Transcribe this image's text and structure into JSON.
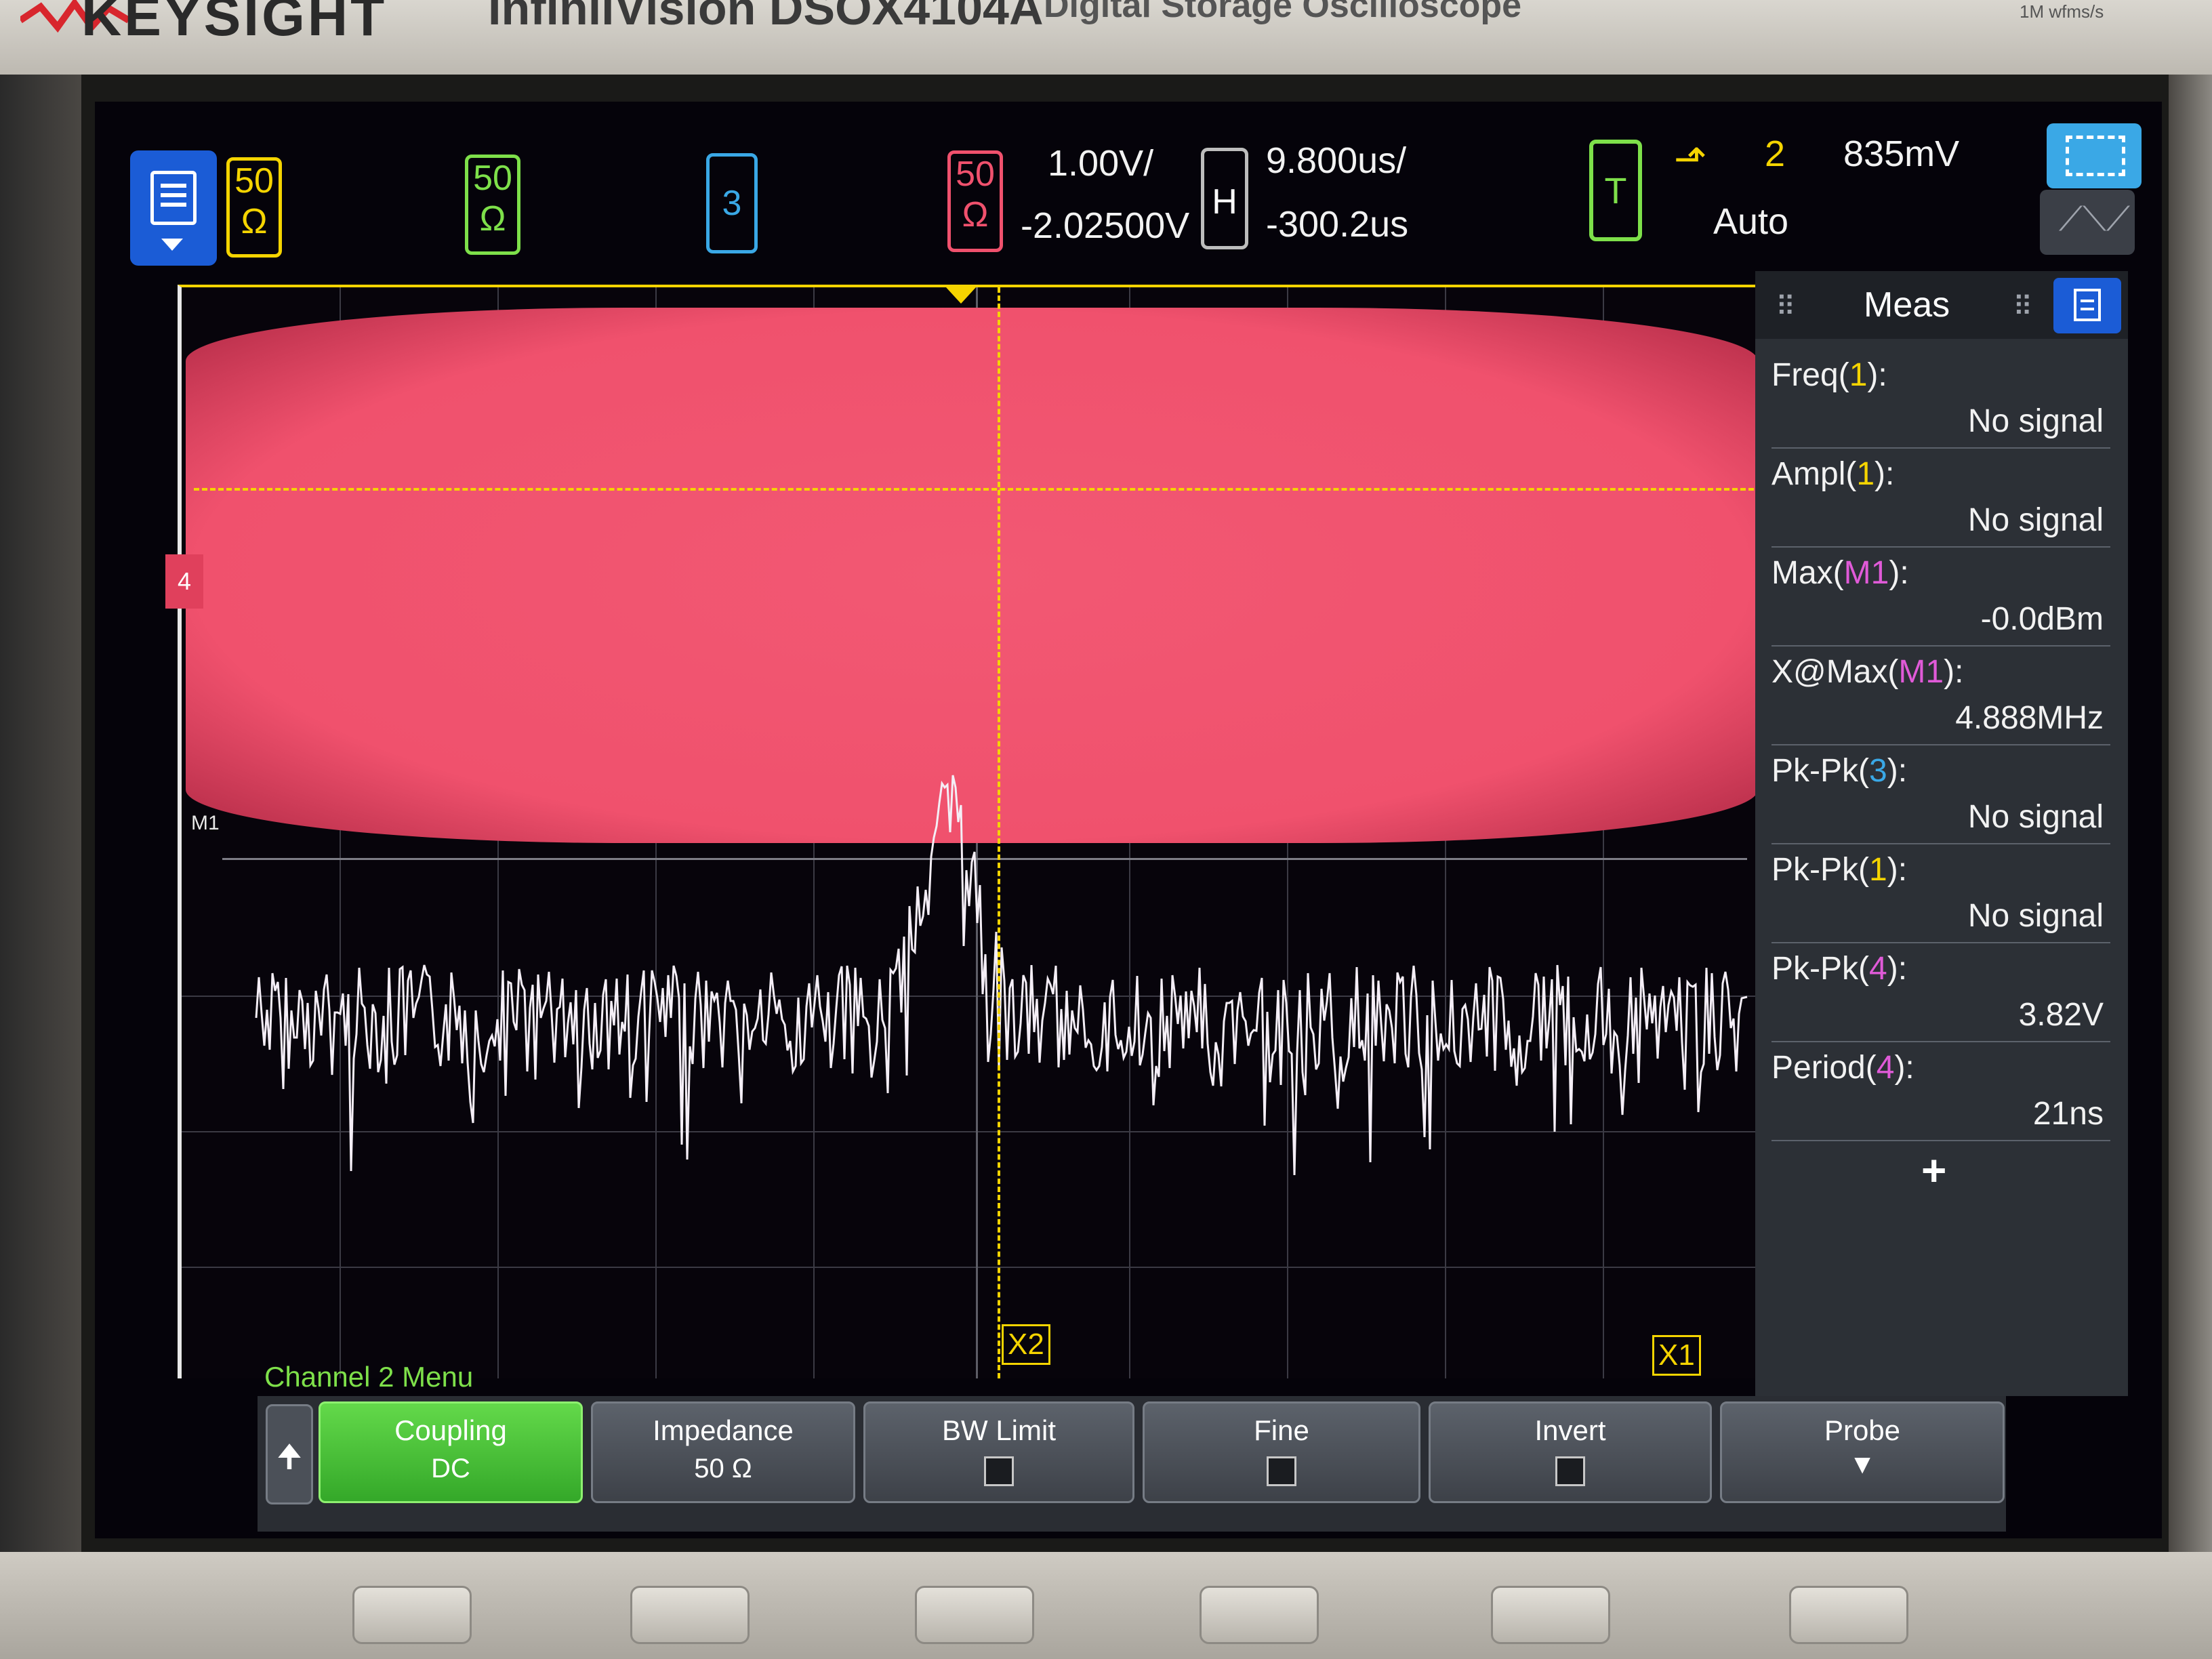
{
  "bezel": {
    "brand": "KEYSIGHT",
    "model": "InfiniiVision DSOX4104A",
    "series": "Digital Storage Oscilloscope",
    "rate": "1M wfms/s"
  },
  "channels": [
    {
      "id": "1",
      "label_top": "50",
      "label_bottom": "Ω",
      "color": "#f5d400"
    },
    {
      "id": "2",
      "label_top": "50",
      "label_bottom": "Ω",
      "color": "#7ee04a"
    },
    {
      "id": "3",
      "label_top": "3",
      "label_bottom": "",
      "color": "#3aa8e6"
    },
    {
      "id": "4",
      "label_top": "50",
      "label_bottom": "Ω",
      "color": "#f0516d"
    }
  ],
  "vertical": {
    "scale": "1.00V/",
    "offset": "-2.02500V"
  },
  "horizontal": {
    "label": "H",
    "scale": "9.800us/",
    "delay": "-300.2us"
  },
  "trigger": {
    "label": "T",
    "source": "2",
    "mode": "Auto",
    "level": "835mV",
    "edge_symbol": "⬏"
  },
  "waveform": {
    "cursor_x2_label": "X2",
    "cursor_x1_label": "X1",
    "ch4_marker": "4",
    "m1_marker": "M1"
  },
  "measurements": {
    "title": "Meas",
    "add_symbol": "+",
    "items": [
      {
        "name_pre": "Freq(",
        "source": "1",
        "name_post": "):",
        "value": "No signal"
      },
      {
        "name_pre": "Ampl(",
        "source": "1",
        "name_post": "):",
        "value": "No signal"
      },
      {
        "name_pre": "Max(",
        "source": "M1",
        "name_post": "):",
        "value": "-0.0dBm"
      },
      {
        "name_pre": "X@Max(",
        "source": "M1",
        "name_post": "):",
        "value": "4.888MHz"
      },
      {
        "name_pre": "Pk-Pk(",
        "source": "3",
        "name_post": "):",
        "value": "No signal"
      },
      {
        "name_pre": "Pk-Pk(",
        "source": "1",
        "name_post": "):",
        "value": "No signal"
      },
      {
        "name_pre": "Pk-Pk(",
        "source": "4",
        "name_post": "):",
        "value": "3.82V"
      },
      {
        "name_pre": "Period(",
        "source": "4",
        "name_post": "):",
        "value": "21ns"
      }
    ]
  },
  "softkeys": {
    "menu_title": "Channel 2 Menu",
    "back_symbol": "🠉",
    "coupling": {
      "label": "Coupling",
      "value": "DC"
    },
    "impedance": {
      "label": "Impedance",
      "value": "50 Ω"
    },
    "bw_limit": {
      "label": "BW Limit"
    },
    "fine": {
      "label": "Fine"
    },
    "invert": {
      "label": "Invert"
    },
    "probe": {
      "label": "Probe"
    }
  },
  "icon_names": [
    "main-menu-icon",
    "select-zoom-icon",
    "ruler-icon",
    "meas-menu-icon",
    "trigger-edge-icon",
    "back-arrow-icon"
  ]
}
